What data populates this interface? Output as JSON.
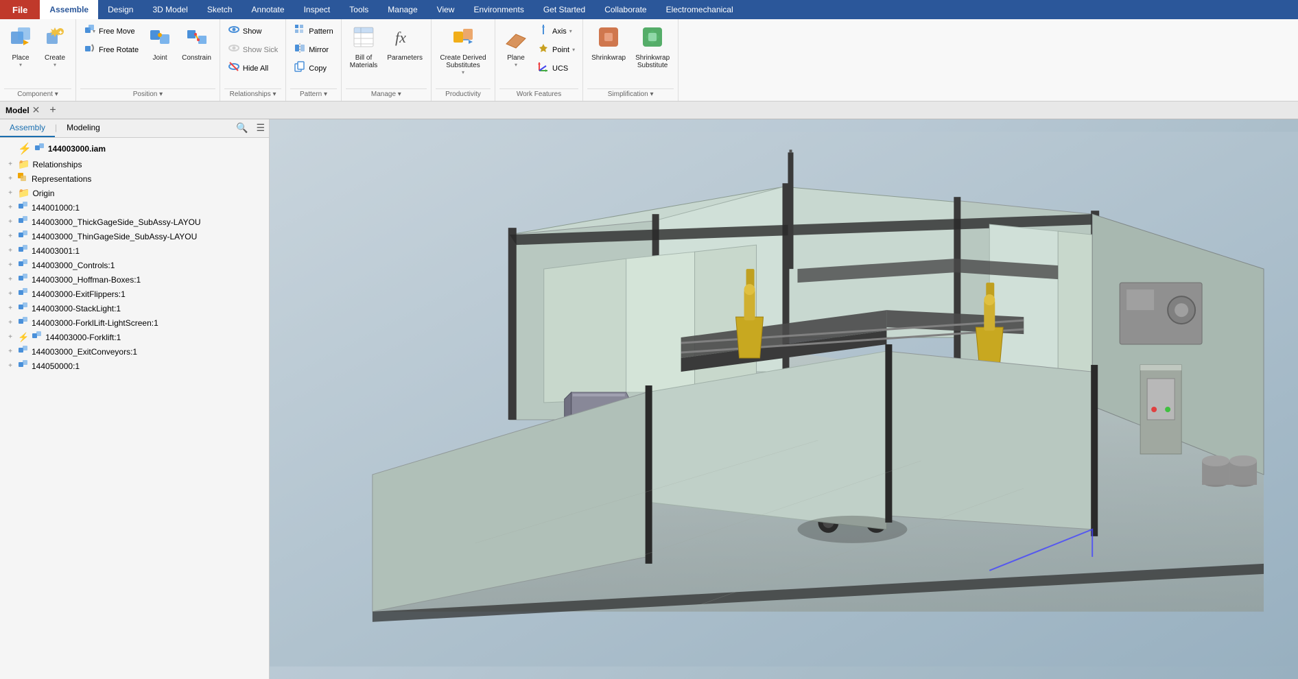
{
  "menubar": {
    "file_label": "File",
    "tabs": [
      "Assemble",
      "Design",
      "3D Model",
      "Sketch",
      "Annotate",
      "Inspect",
      "Tools",
      "Manage",
      "View",
      "Environments",
      "Get Started",
      "Collaborate",
      "Electromechanical"
    ],
    "active_tab": "Assemble"
  },
  "ribbon": {
    "groups": [
      {
        "label": "Component",
        "items": [
          {
            "id": "place",
            "label": "Place",
            "icon": "⬇",
            "dropdown": true
          },
          {
            "id": "create",
            "label": "Create",
            "icon": "✦",
            "dropdown": true
          }
        ]
      },
      {
        "label": "Position",
        "items": [
          {
            "id": "free-move",
            "label": "Free Move",
            "icon": "✥",
            "small": true
          },
          {
            "id": "free-rotate",
            "label": "Free Rotate",
            "icon": "↻",
            "small": true
          },
          {
            "id": "joint",
            "label": "Joint",
            "icon": "⬡",
            "large": true
          },
          {
            "id": "constrain",
            "label": "Constrain",
            "icon": "🔒",
            "large": true
          }
        ]
      },
      {
        "label": "Relationships",
        "items": [
          {
            "id": "show",
            "label": "Show",
            "icon": "👁",
            "small": true
          },
          {
            "id": "show-sick",
            "label": "Show Sick",
            "icon": "⚠",
            "small": true,
            "disabled": true
          },
          {
            "id": "hide-all",
            "label": "Hide All",
            "icon": "🚫",
            "small": true
          }
        ]
      },
      {
        "label": "Pattern",
        "items": [
          {
            "id": "pattern",
            "label": "Pattern",
            "icon": "⊞",
            "small": true
          },
          {
            "id": "mirror",
            "label": "Mirror",
            "icon": "◫",
            "small": true
          },
          {
            "id": "copy",
            "label": "Copy",
            "icon": "⧉",
            "small": true
          }
        ]
      },
      {
        "label": "Manage",
        "items": [
          {
            "id": "bom",
            "label": "Bill of\nMaterials",
            "icon": "📋"
          },
          {
            "id": "parameters",
            "label": "Parameters",
            "icon": "fx"
          }
        ]
      },
      {
        "label": "Productivity",
        "items": [
          {
            "id": "create-derived",
            "label": "Create Derived\nSubstitutes",
            "icon": "⚙",
            "dropdown": true
          }
        ]
      },
      {
        "label": "Work Features",
        "items": [
          {
            "id": "plane",
            "label": "Plane",
            "icon": "◻",
            "dropdown": true
          },
          {
            "id": "axis",
            "label": "Axis",
            "icon": "↕",
            "small": true,
            "dropdown": true
          },
          {
            "id": "point",
            "label": "Point",
            "icon": "◆",
            "small": true,
            "dropdown": true
          },
          {
            "id": "ucs",
            "label": "UCS",
            "icon": "⊹",
            "small": true
          }
        ]
      },
      {
        "label": "Simplification",
        "items": [
          {
            "id": "shrinkwrap",
            "label": "Shrinkwrap",
            "icon": "🟧"
          },
          {
            "id": "shrinkwrap-sub",
            "label": "Shrinkwrap\nSubstitute",
            "icon": "🟩"
          }
        ]
      }
    ]
  },
  "subtoolbar": {
    "model_label": "Model",
    "assembly_tab": "Assembly",
    "modeling_tab": "Modeling",
    "search_placeholder": "Search"
  },
  "tree": {
    "root": "144003000.iam",
    "items": [
      {
        "id": "relationships",
        "label": "Relationships",
        "icon": "folder-yellow",
        "indent": 1,
        "expand": true
      },
      {
        "id": "representations",
        "label": "Representations",
        "icon": "folder-special",
        "indent": 1,
        "expand": true
      },
      {
        "id": "origin",
        "label": "Origin",
        "icon": "folder-yellow",
        "indent": 1,
        "expand": true
      },
      {
        "id": "item1",
        "label": "144001000:1",
        "icon": "part",
        "indent": 1,
        "expand": true
      },
      {
        "id": "item2",
        "label": "144003000_ThickGageSide_SubAssy-LAYOU",
        "icon": "part",
        "indent": 1,
        "expand": true
      },
      {
        "id": "item3",
        "label": "144003000_ThinGageSide_SubAssy-LAYOU",
        "icon": "part",
        "indent": 1,
        "expand": true
      },
      {
        "id": "item4",
        "label": "144003001:1",
        "icon": "part",
        "indent": 1,
        "expand": true
      },
      {
        "id": "item5",
        "label": "144003000_Controls:1",
        "icon": "part",
        "indent": 1,
        "expand": true
      },
      {
        "id": "item6",
        "label": "144003000_Hoffman-Boxes:1",
        "icon": "part",
        "indent": 1,
        "expand": true
      },
      {
        "id": "item7",
        "label": "144003000-ExitFlippers:1",
        "icon": "part",
        "indent": 1,
        "expand": true
      },
      {
        "id": "item8",
        "label": "144003000-StackLight:1",
        "icon": "part",
        "indent": 1,
        "expand": true
      },
      {
        "id": "item9",
        "label": "144003000-ForklLift-LightScreen:1",
        "icon": "part",
        "indent": 1,
        "expand": true
      },
      {
        "id": "item10",
        "label": "144003000-Forklift:1",
        "icon": "part",
        "indent": 1,
        "expand": true,
        "lightning": true
      },
      {
        "id": "item11",
        "label": "144003000_ExitConveyors:1",
        "icon": "part",
        "indent": 1,
        "expand": true
      },
      {
        "id": "item12",
        "label": "144050000:1",
        "icon": "part",
        "indent": 1,
        "expand": true
      }
    ]
  },
  "colors": {
    "accent": "#2b579a",
    "active_tab": "#1a6fb0",
    "file_bg": "#c0392b",
    "ribbon_bg": "#f8f8f8"
  }
}
